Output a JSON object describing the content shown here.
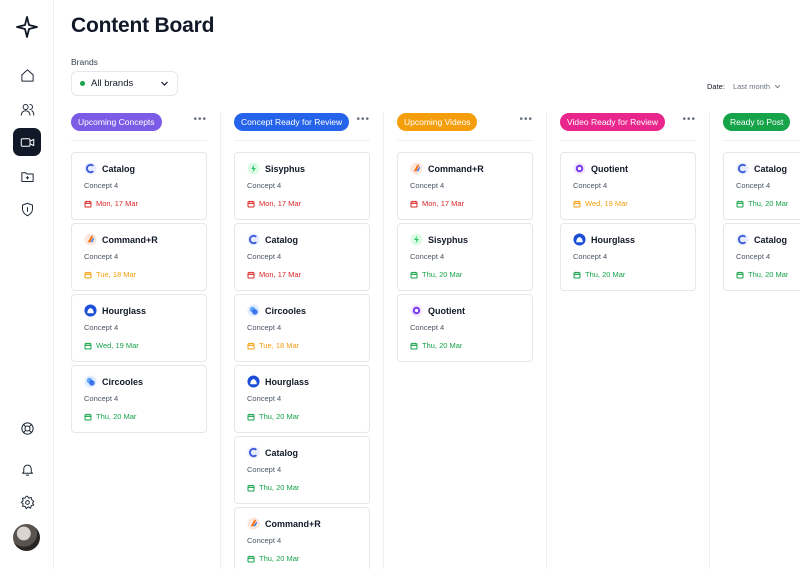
{
  "page": {
    "title": "Content Board"
  },
  "filters": {
    "brands_label": "Brands",
    "brands_value": "All brands",
    "date_label": "Date:",
    "date_value": "Last month"
  },
  "nav": {
    "items": [
      {
        "icon": "home-icon"
      },
      {
        "icon": "users-icon"
      },
      {
        "icon": "video-icon",
        "active": true
      },
      {
        "icon": "folder-icon"
      },
      {
        "icon": "shield-icon"
      },
      {
        "icon": "lifebuoy-icon"
      },
      {
        "icon": "bell-icon"
      },
      {
        "icon": "gear-icon"
      }
    ]
  },
  "colors": {
    "purple": "#7c5ce6",
    "blue": "#2563eb",
    "orange": "#f59e0b",
    "pink": "#e8268c",
    "green": "#16a34a",
    "date_red": "#dc2626",
    "date_orange": "#f59e0b",
    "date_green": "#16a34a"
  },
  "columns": [
    {
      "name": "Upcoming Concepts",
      "color": "#7c5ce6",
      "cards": [
        {
          "brand": "Catalog",
          "concept": "Concept 4",
          "date": "Mon, 17 Mar",
          "status": "red"
        },
        {
          "brand": "Command+R",
          "concept": "Concept 4",
          "date": "Tue, 18 Mar",
          "status": "orange"
        },
        {
          "brand": "Hourglass",
          "concept": "Concept 4",
          "date": "Wed, 19 Mar",
          "status": "green"
        },
        {
          "brand": "Circooles",
          "concept": "Concept 4",
          "date": "Thu, 20 Mar",
          "status": "green"
        }
      ]
    },
    {
      "name": "Concept Ready for Review",
      "color": "#2563eb",
      "cards": [
        {
          "brand": "Sisyphus",
          "concept": "Concept 4",
          "date": "Mon, 17 Mar",
          "status": "red"
        },
        {
          "brand": "Catalog",
          "concept": "Concept 4",
          "date": "Mon, 17 Mar",
          "status": "red"
        },
        {
          "brand": "Circooles",
          "concept": "Concept 4",
          "date": "Tue, 18 Mar",
          "status": "orange"
        },
        {
          "brand": "Hourglass",
          "concept": "Concept 4",
          "date": "Thu, 20 Mar",
          "status": "green"
        },
        {
          "brand": "Catalog",
          "concept": "Concept 4",
          "date": "Thu, 20 Mar",
          "status": "green"
        },
        {
          "brand": "Command+R",
          "concept": "Concept 4",
          "date": "Thu, 20 Mar",
          "status": "green"
        }
      ]
    },
    {
      "name": "Upcoming Videos",
      "color": "#f59e0b",
      "cards": [
        {
          "brand": "Command+R",
          "concept": "Concept 4",
          "date": "Mon, 17 Mar",
          "status": "red"
        },
        {
          "brand": "Sisyphus",
          "concept": "Concept 4",
          "date": "Thu, 20 Mar",
          "status": "green"
        },
        {
          "brand": "Quotient",
          "concept": "Concept 4",
          "date": "Thu, 20 Mar",
          "status": "green"
        }
      ]
    },
    {
      "name": "Video Ready for Review",
      "color": "#e8268c",
      "cards": [
        {
          "brand": "Quotient",
          "concept": "Concept 4",
          "date": "Wed, 19 Mar",
          "status": "orange"
        },
        {
          "brand": "Hourglass",
          "concept": "Concept 4",
          "date": "Thu, 20 Mar",
          "status": "green"
        }
      ]
    },
    {
      "name": "Ready to Post",
      "color": "#16a34a",
      "cards": [
        {
          "brand": "Catalog",
          "concept": "Concept 4",
          "date": "Thu, 20 Mar",
          "status": "green"
        },
        {
          "brand": "Catalog",
          "concept": "Concept 4",
          "date": "Thu, 20 Mar",
          "status": "green"
        }
      ]
    }
  ]
}
